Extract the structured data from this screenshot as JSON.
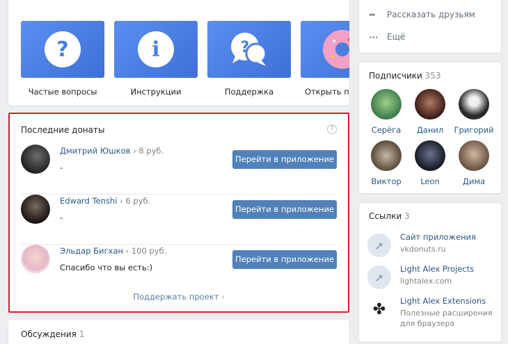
{
  "apps": [
    {
      "label": "Частые вопросы",
      "glyph": "?",
      "icon": "question-icon"
    },
    {
      "label": "Инструкции",
      "glyph": "i",
      "icon": "info-icon"
    },
    {
      "label": "Поддержка",
      "glyph": "?",
      "icon": "chat-bubbles-icon"
    },
    {
      "label": "Открыть при",
      "glyph": "",
      "icon": "donut-icon"
    }
  ],
  "donations": {
    "title": "Последние донаты",
    "help_glyph": "?",
    "rows": [
      {
        "name": "Дмитрий Юшков",
        "sep": "›",
        "amount": "8 руб.",
        "message": "-",
        "button": "Перейти в приложение"
      },
      {
        "name": "Edward Tenshi",
        "sep": "›",
        "amount": "6 руб.",
        "message": "-",
        "button": "Перейти в приложение"
      },
      {
        "name": "Эльдар Бигхан",
        "sep": "›",
        "amount": "100 руб.",
        "message": "Спасибо что вы есть:)",
        "button": "Перейти в приложение"
      }
    ],
    "support_link": "Поддержать проект",
    "support_chevron": "›"
  },
  "discussions": {
    "title": "Обсуждения",
    "count": "1"
  },
  "share": {
    "tell_friends": "Рассказать друзьям",
    "more": "Ещё",
    "share_glyph": "➦",
    "more_glyph": "•••"
  },
  "subscribers": {
    "title": "Подписчики",
    "count": "353",
    "items": [
      {
        "name": "Серёга",
        "color": "#3b7a4a"
      },
      {
        "name": "Данил",
        "color": "#6a3a2a"
      },
      {
        "name": "Григорий",
        "color": "#2b2b2b"
      },
      {
        "name": "Виктор",
        "color": "#7a6a5a"
      },
      {
        "name": "Leon",
        "color": "#2a3040"
      },
      {
        "name": "Дима",
        "color": "#8a7060"
      }
    ]
  },
  "links": {
    "title": "Ссылки",
    "count": "3",
    "items": [
      {
        "name": "Сайт приложения",
        "sub": "vkdonuts.ru",
        "glyph": "➚",
        "icon": "link-arrow-icon"
      },
      {
        "name": "Light Alex Projects",
        "sub": "lightalex.com",
        "glyph": "➚",
        "icon": "link-arrow-icon"
      },
      {
        "name": "Light Alex Extensions",
        "sub": "Полезные расширения для браузера",
        "sub1": "Полезные расширения",
        "sub2": "для браузера",
        "glyph": "✤",
        "icon": "puzzle-icon"
      }
    ]
  },
  "colors": {
    "accent": "#5181b8",
    "link": "#2a5885",
    "highlight_border": "#d0212a",
    "app_blue": "#4a7fe0"
  }
}
